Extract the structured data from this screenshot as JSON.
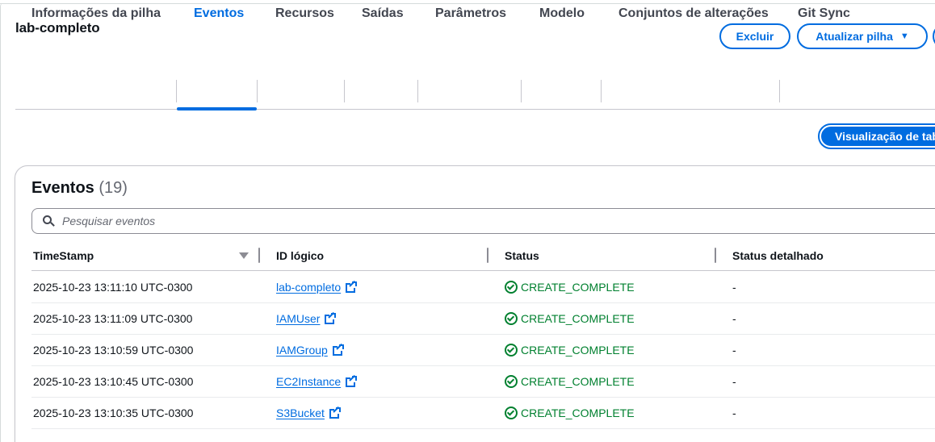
{
  "stack": {
    "name": "lab-completo"
  },
  "actions": {
    "delete_label": "Excluir",
    "update_label": "Atualizar pilha",
    "update_caret": "▼"
  },
  "tabs": [
    {
      "label": "Informações da pilha",
      "active": false
    },
    {
      "label": "Eventos",
      "active": true
    },
    {
      "label": "Recursos",
      "active": false
    },
    {
      "label": "Saídas",
      "active": false
    },
    {
      "label": "Parâmetros",
      "active": false
    },
    {
      "label": "Modelo",
      "active": false
    },
    {
      "label": "Conjuntos de alterações",
      "active": false
    },
    {
      "label": "Git Sync",
      "active": false
    }
  ],
  "view_toggle": {
    "label": "Visualização de tabela"
  },
  "events": {
    "title": "Eventos",
    "count": "(19)",
    "search_placeholder": "Pesquisar eventos",
    "columns": [
      "TimeStamp",
      "ID lógico",
      "Status",
      "Status detalhado"
    ],
    "rows": [
      {
        "timestamp": "2025-10-23 13:11:10 UTC-0300",
        "logical_id": "lab-completo",
        "status": "CREATE_COMPLETE",
        "detail": "-"
      },
      {
        "timestamp": "2025-10-23 13:11:09 UTC-0300",
        "logical_id": "IAMUser",
        "status": "CREATE_COMPLETE",
        "detail": "-"
      },
      {
        "timestamp": "2025-10-23 13:10:59 UTC-0300",
        "logical_id": "IAMGroup",
        "status": "CREATE_COMPLETE",
        "detail": "-"
      },
      {
        "timestamp": "2025-10-23 13:10:45 UTC-0300",
        "logical_id": "EC2Instance",
        "status": "CREATE_COMPLETE",
        "detail": "-"
      },
      {
        "timestamp": "2025-10-23 13:10:35 UTC-0300",
        "logical_id": "S3Bucket",
        "status": "CREATE_COMPLETE",
        "detail": "-"
      }
    ]
  },
  "colors": {
    "accent": "#006ce0",
    "success": "#00802f",
    "text": "#0f141a",
    "muted": "#656871"
  },
  "icons": {
    "search": "search-icon",
    "external": "external-link-icon",
    "status_ok": "status-success-icon",
    "sort": "sort-descending-icon"
  }
}
